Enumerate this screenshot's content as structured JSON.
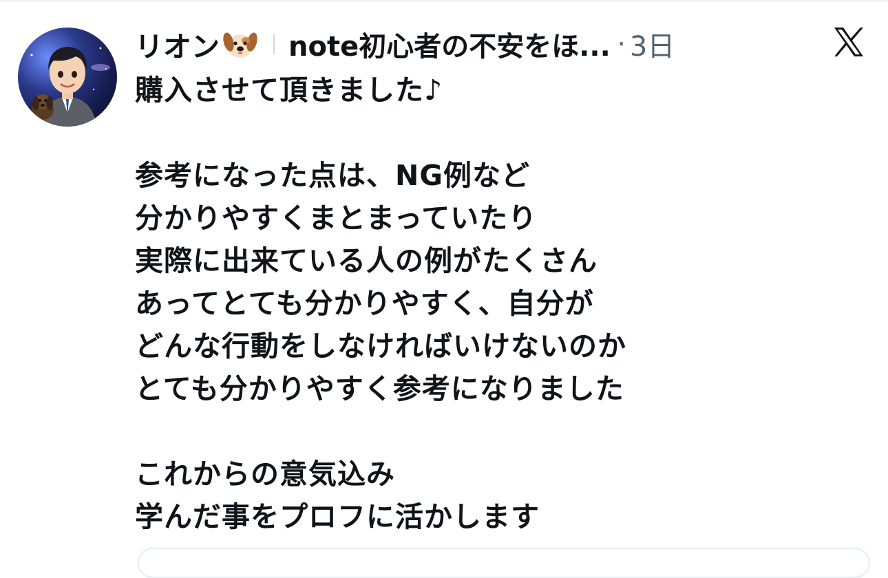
{
  "post": {
    "author_name": "リオン",
    "author_bio": "note初心者の不安をほ...",
    "dot": "·",
    "time": "3日",
    "lines": [
      "購入させて頂きました♪",
      "",
      "参考になった点は、NG例など",
      "分かりやすくまとまっていたり",
      "実際に出来ている人の例がたくさん",
      "あってとても分かりやすく、自分が",
      "どんな行動をしなければいけないのか",
      "とても分かりやすく参考になりました",
      "",
      "これからの意気込み",
      "学んだ事をプロフに活かします"
    ]
  },
  "icons": {
    "avatar": "avatar-image",
    "name_emoji": "dog-face-icon",
    "platform": "x-logo-icon"
  }
}
